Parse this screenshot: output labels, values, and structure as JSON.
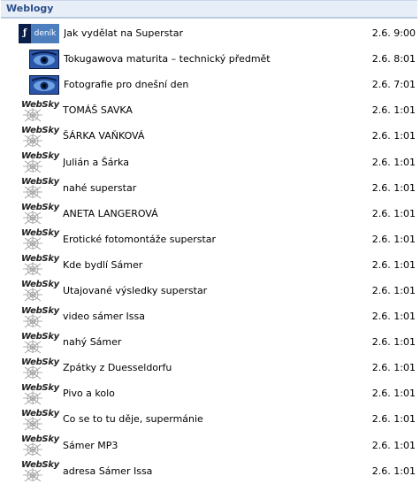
{
  "header": {
    "title": "Weblogy"
  },
  "icons": {
    "denik_label": "deník",
    "websky_label": "WebSky"
  },
  "entries": [
    {
      "icon": "denik-icon",
      "title": "Jak vydělat na Superstar",
      "date": "2.6. 9:00"
    },
    {
      "icon": "photo-icon",
      "title": "Tokugawova maturita – technický předmět",
      "date": "2.6. 8:01"
    },
    {
      "icon": "photo-icon",
      "title": "Fotografie pro dnešní den",
      "date": "2.6. 7:01"
    },
    {
      "icon": "websky-icon",
      "title": "TOMÁŠ SAVKA",
      "date": "2.6. 1:01"
    },
    {
      "icon": "websky-icon",
      "title": "ŠÁRKA VAŇKOVÁ",
      "date": "2.6. 1:01"
    },
    {
      "icon": "websky-icon",
      "title": "Julián a Šárka",
      "date": "2.6. 1:01"
    },
    {
      "icon": "websky-icon",
      "title": "nahé superstar",
      "date": "2.6. 1:01"
    },
    {
      "icon": "websky-icon",
      "title": "ANETA LANGEROVÁ",
      "date": "2.6. 1:01"
    },
    {
      "icon": "websky-icon",
      "title": "Erotické fotomontáže superstar",
      "date": "2.6. 1:01"
    },
    {
      "icon": "websky-icon",
      "title": "Kde bydlí Sámer",
      "date": "2.6. 1:01"
    },
    {
      "icon": "websky-icon",
      "title": "Utajované výsledky superstar",
      "date": "2.6. 1:01"
    },
    {
      "icon": "websky-icon",
      "title": "video sámer Issa",
      "date": "2.6. 1:01"
    },
    {
      "icon": "websky-icon",
      "title": "nahý Sámer",
      "date": "2.6. 1:01"
    },
    {
      "icon": "websky-icon",
      "title": "Zpátky z Duesseldorfu",
      "date": "2.6. 1:01"
    },
    {
      "icon": "websky-icon",
      "title": "Pivo a kolo",
      "date": "2.6. 1:01"
    },
    {
      "icon": "websky-icon",
      "title": "Co se to tu děje, supermánie",
      "date": "2.6. 1:01"
    },
    {
      "icon": "websky-icon",
      "title": "Sámer MP3",
      "date": "2.6. 1:01"
    },
    {
      "icon": "websky-icon",
      "title": "adresa Sámer Issa",
      "date": "2.6. 1:01"
    }
  ]
}
